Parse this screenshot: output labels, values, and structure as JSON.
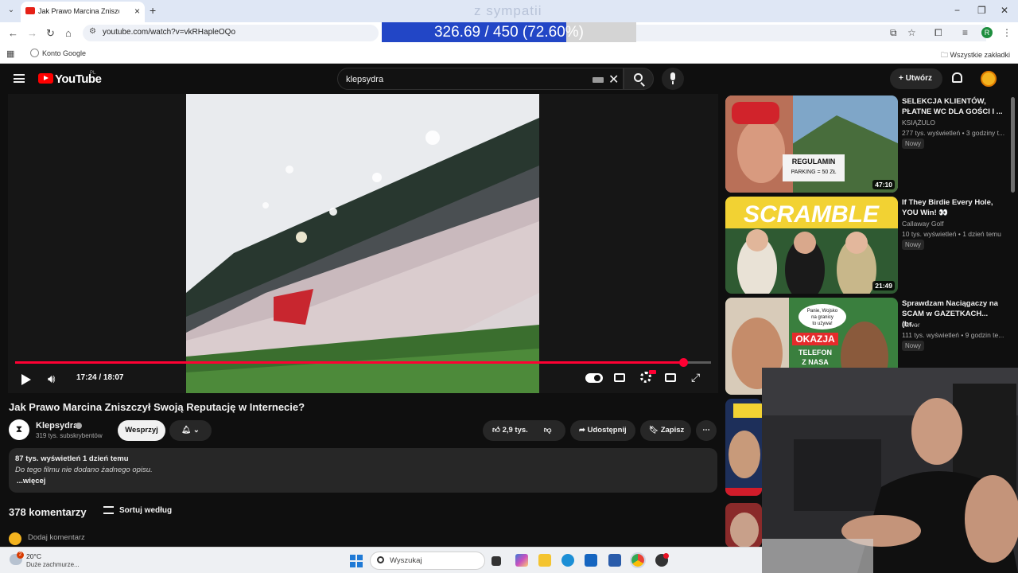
{
  "browser": {
    "tab_title": "Jak Prawo Marcina Zniszczył Swoją Reputację w Internecie?",
    "url": "youtube.com/watch?v=vkRHapleOQo",
    "bookmark": "Konto Google",
    "all_bookmarks": "Wszystkie zakładki",
    "profile_letter": "R",
    "colors": {
      "tabstrip": "#dfe7f5",
      "accent": "#2246c6"
    }
  },
  "stream_overlay": {
    "goal_title": "z sympatii",
    "goal_text": "326.69 / 450 (72.60%)",
    "goal_fraction": 0.726
  },
  "youtube": {
    "logo_word": "YouTube",
    "region": "PL",
    "search_value": "klepsydra",
    "create_label": "Utwórz",
    "colors": {
      "brand": "#ff0000",
      "progress": "#ff0033",
      "bg": "#0f0f0f"
    }
  },
  "player": {
    "time": "17:24 / 18:07",
    "progress_fraction": 0.96
  },
  "video": {
    "title": "Jak Prawo Marcina Zniszczył Swoją Reputację w Internecie?",
    "channel": "Klepsydra",
    "subscribers": "319 tys. subskrybentów",
    "support_label": "Wesprzyj",
    "likes": "2,9 tys.",
    "share_label": "Udostępnij",
    "save_label": "Zapisz",
    "stats": "87 tys. wyświetleń  1 dzień temu",
    "description": "Do tego filmu nie dodano żadnego opisu.",
    "more_label": "...więcej"
  },
  "comments": {
    "count_label": "378 komentarzy",
    "sort_label": "Sortuj według",
    "add_placeholder": "Dodaj komentarz"
  },
  "recommendations": [
    {
      "title": "SELEKCJA KLIENTÓW, PŁATNE WC DLA GOŚCI I ...",
      "channel": "KSIĄŻULO",
      "meta": "277 tys. wyświetleń • 3 godziny t...",
      "badge": "Nowy",
      "duration": "47:10",
      "thumb_text": "REGULAMIN PARKING = 50 ZŁ"
    },
    {
      "title": "If They Birdie Every Hole, YOU Win! 👀",
      "channel": "Callaway Golf",
      "meta": "10 tys. wyświetleń • 1 dzień temu",
      "badge": "Nowy",
      "duration": "21:49",
      "thumb_text": "SCRAMBLE"
    },
    {
      "title": "Sprawdzam Naciągaczy na SCAM w GAZETKACH... (br...",
      "channel": "Jawor",
      "meta": "111 tys. wyświetleń • 9 godzin te...",
      "badge": "Nowy",
      "duration": "",
      "thumb_text": "OKAZJA TELEFON Z NASA",
      "thumb_bubble": "Panie, Wojsko na granicy to używa!"
    },
    {
      "title": "",
      "channel": "",
      "meta": "",
      "badge": "",
      "duration": ""
    }
  ],
  "taskbar": {
    "temperature": "20°C",
    "weather": "Duże zachmurze...",
    "weather_badge": "2",
    "search_placeholder": "Wyszukaj"
  }
}
